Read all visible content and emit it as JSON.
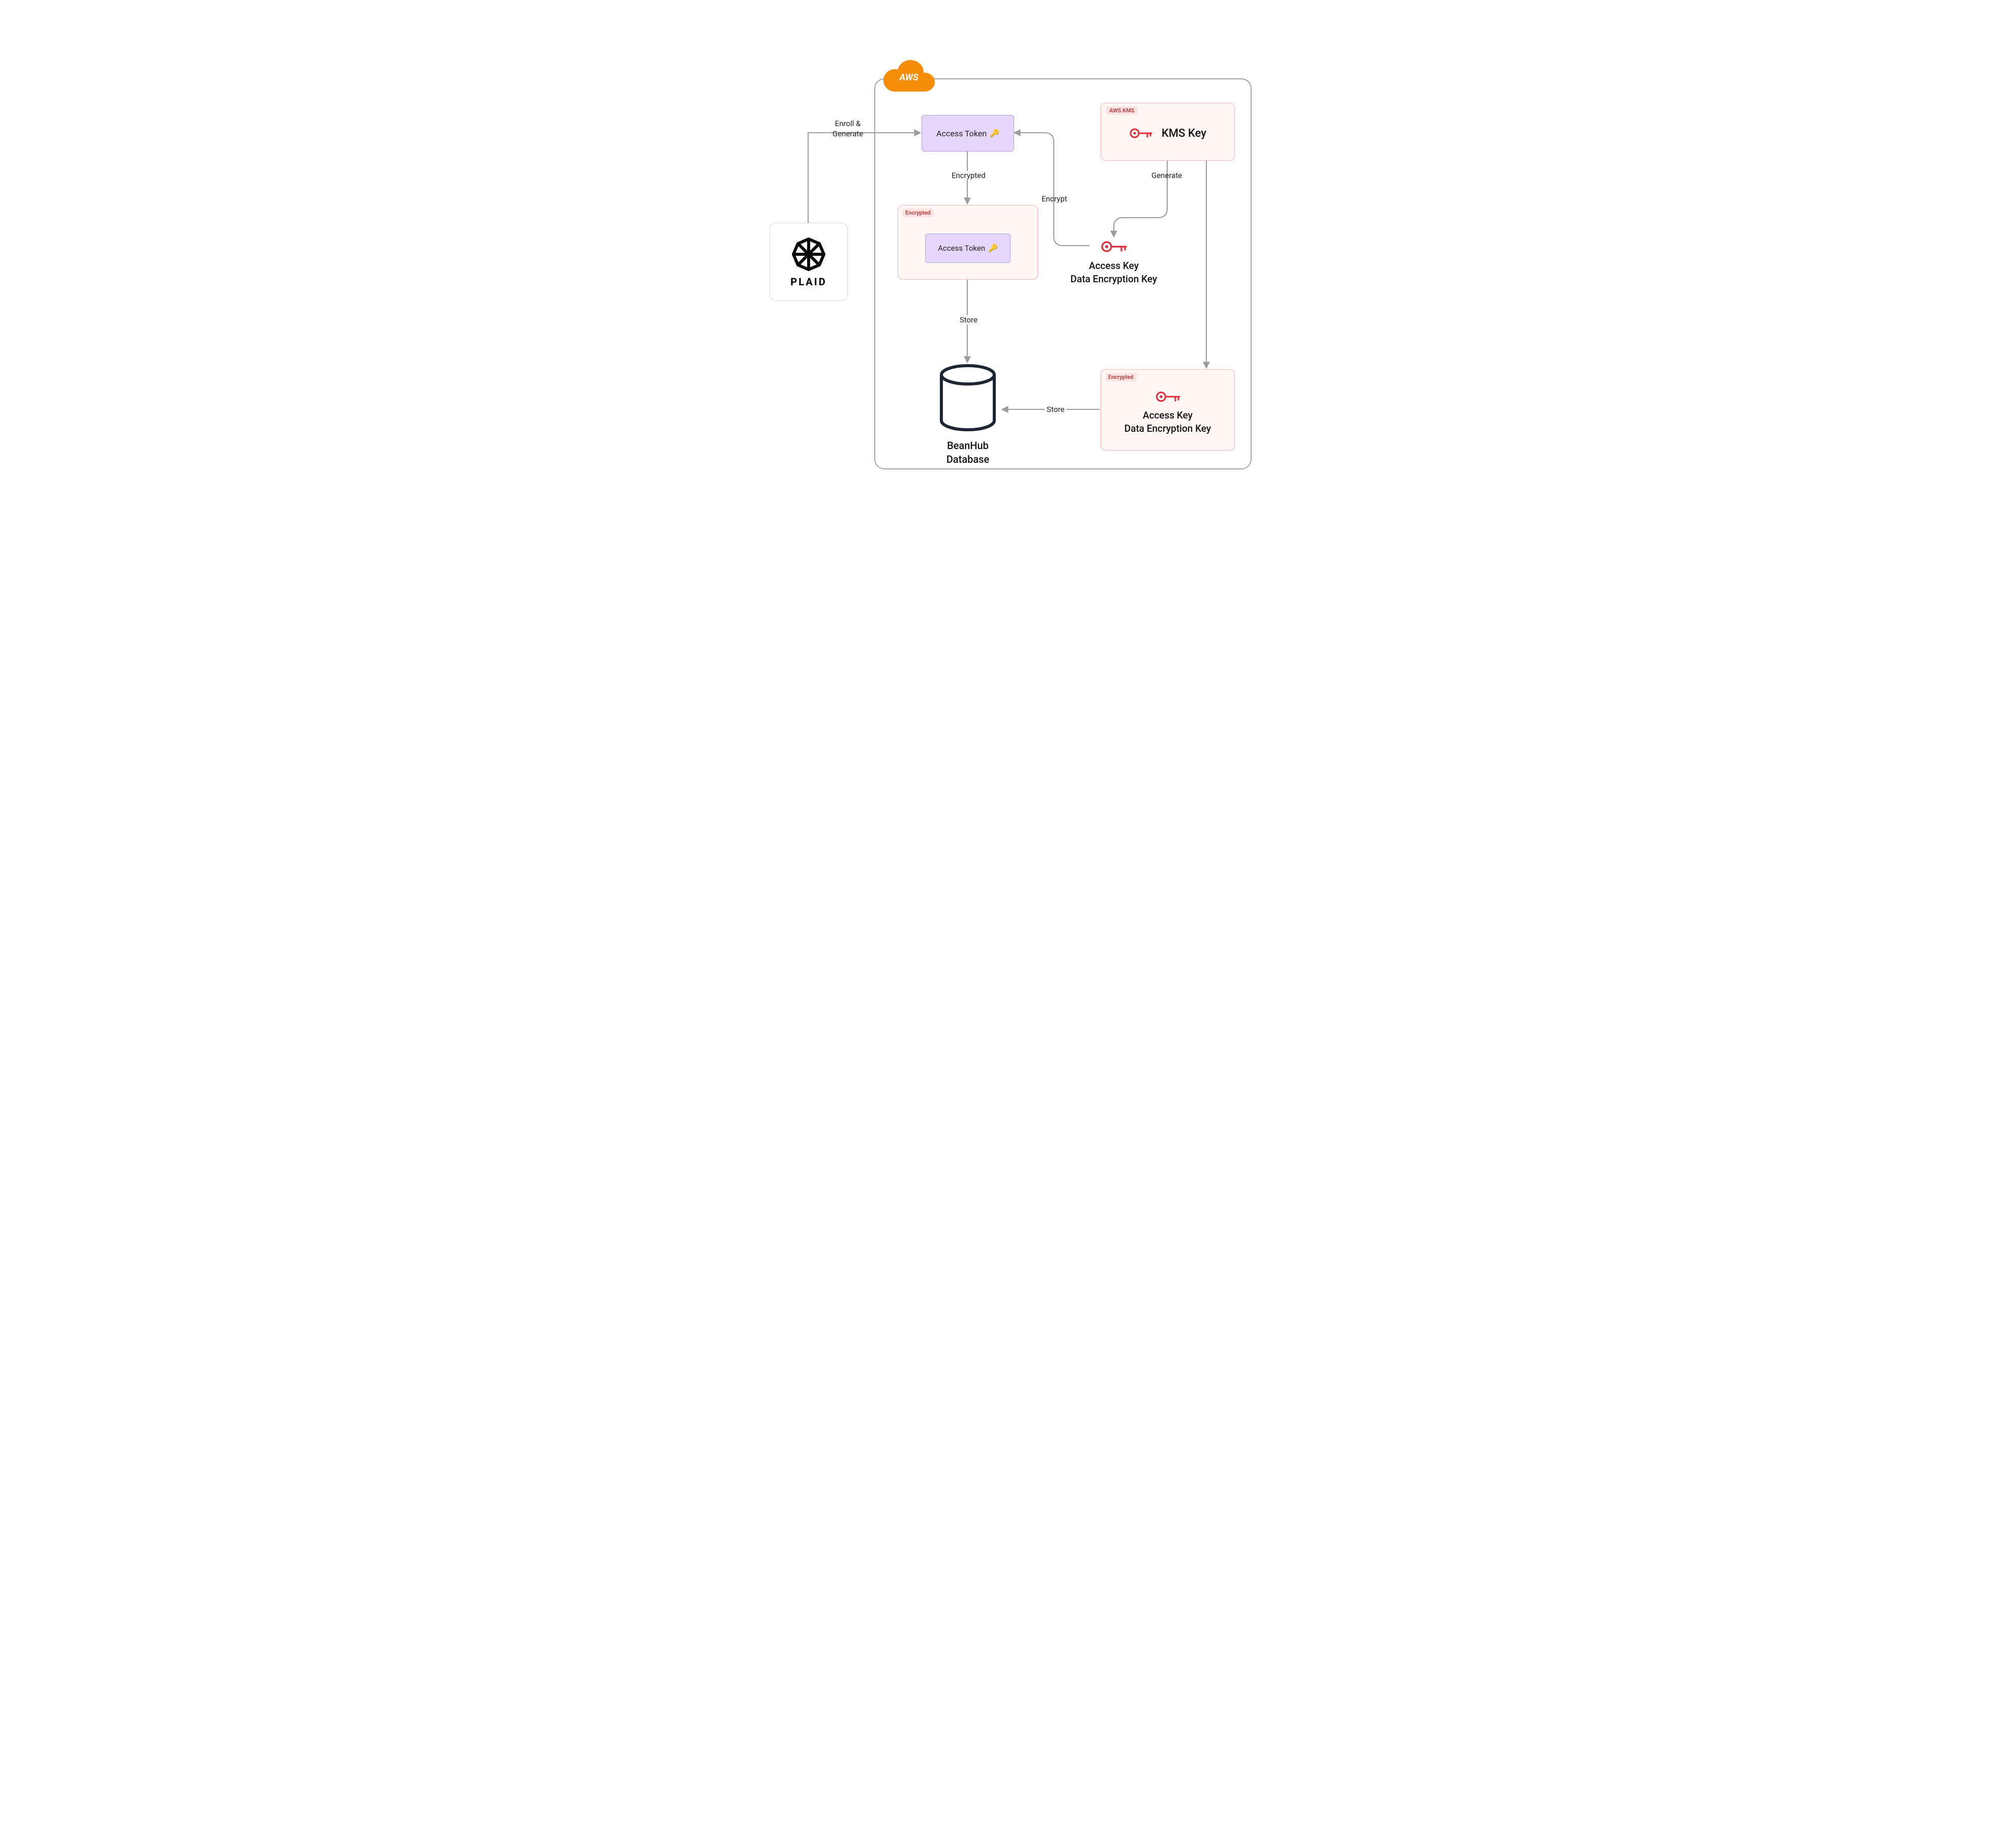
{
  "aws": {
    "label": "AWS"
  },
  "plaid": {
    "label": "PLAID"
  },
  "token_plain": {
    "label": "Access Token"
  },
  "token_enc_box": {
    "tag": "Encrypted",
    "inner_label": "Access Token"
  },
  "kms": {
    "tag": "AWS KMS",
    "label": "KMS Key"
  },
  "dek_plain": {
    "line1": "Access Key",
    "line2": "Data Encryption Key"
  },
  "dek_enc": {
    "tag": "Encrypted",
    "line1": "Access Key",
    "line2": "Data Encryption Key"
  },
  "database": {
    "line1": "BeanHub",
    "line2": "Database"
  },
  "edges": {
    "enroll": "Enroll &\nGenerate",
    "encrypted": "Encrypted",
    "encrypt": "Encrypt",
    "generate": "Generate",
    "store1": "Store",
    "store2": "Store"
  }
}
